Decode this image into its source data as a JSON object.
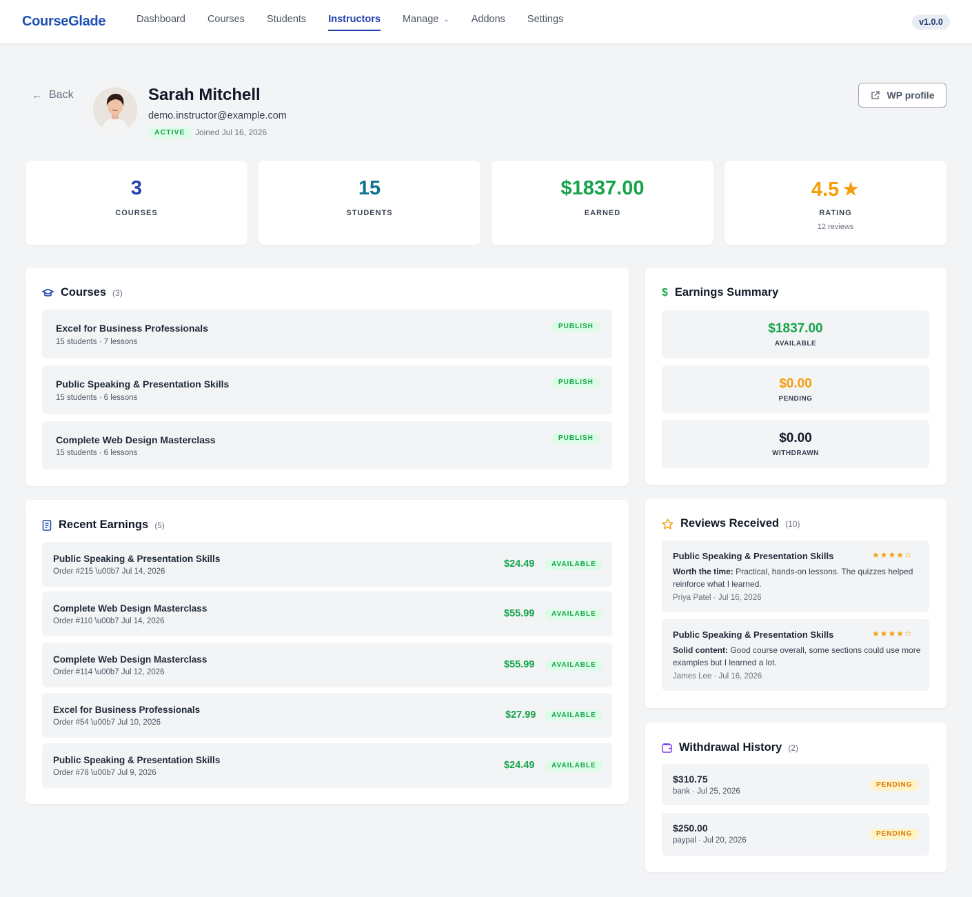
{
  "app": {
    "logo": "CourseGlade",
    "version": "v1.0.0"
  },
  "nav": {
    "items": [
      {
        "label": "Dashboard",
        "active": false
      },
      {
        "label": "Courses",
        "active": false
      },
      {
        "label": "Students",
        "active": false
      },
      {
        "label": "Instructors",
        "active": true
      },
      {
        "label": "Manage",
        "active": false,
        "dropdown": true
      },
      {
        "label": "Addons",
        "active": false
      },
      {
        "label": "Settings",
        "active": false
      }
    ]
  },
  "profile": {
    "back_label": "Back",
    "name": "Sarah Mitchell",
    "email": "demo.instructor@example.com",
    "status": "ACTIVE",
    "joined": "Joined Jul 16, 2026",
    "wp_button": "WP profile"
  },
  "stats": {
    "courses": {
      "value": "3",
      "label": "COURSES",
      "color": "#1e40af"
    },
    "students": {
      "value": "15",
      "label": "STUDENTS",
      "color": "#0e7490"
    },
    "earned": {
      "value": "$1837.00",
      "label": "EARNED",
      "color": "#16a34a"
    },
    "rating": {
      "value": "4.5",
      "label": "RATING",
      "sub": "12 reviews",
      "color": "#f59e0b"
    }
  },
  "courses": {
    "title": "Courses",
    "count": "(3)",
    "items": [
      {
        "title": "Excel for Business Professionals",
        "meta": "15 students · 7 lessons",
        "status": "PUBLISH"
      },
      {
        "title": "Public Speaking & Presentation Skills",
        "meta": "15 students · 6 lessons",
        "status": "PUBLISH"
      },
      {
        "title": "Complete Web Design Masterclass",
        "meta": "15 students · 6 lessons",
        "status": "PUBLISH"
      }
    ]
  },
  "earnings_summary": {
    "title": "Earnings Summary",
    "available": {
      "value": "$1837.00",
      "label": "AVAILABLE",
      "color": "#16a34a"
    },
    "pending": {
      "value": "$0.00",
      "label": "PENDING",
      "color": "#f59e0b"
    },
    "withdrawn": {
      "value": "$0.00",
      "label": "WITHDRAWN",
      "color": "#111827"
    }
  },
  "recent_earnings": {
    "title": "Recent Earnings",
    "count": "(5)",
    "items": [
      {
        "title": "Public Speaking & Presentation Skills",
        "meta": "Order #215 \\u00b7 Jul 14, 2026",
        "amount": "$24.49",
        "status": "AVAILABLE"
      },
      {
        "title": "Complete Web Design Masterclass",
        "meta": "Order #110 \\u00b7 Jul 14, 2026",
        "amount": "$55.99",
        "status": "AVAILABLE"
      },
      {
        "title": "Complete Web Design Masterclass",
        "meta": "Order #114 \\u00b7 Jul 12, 2026",
        "amount": "$55.99",
        "status": "AVAILABLE"
      },
      {
        "title": "Excel for Business Professionals",
        "meta": "Order #54 \\u00b7 Jul 10, 2026",
        "amount": "$27.99",
        "status": "AVAILABLE"
      },
      {
        "title": "Public Speaking & Presentation Skills",
        "meta": "Order #78 \\u00b7 Jul 9, 2026",
        "amount": "$24.49",
        "status": "AVAILABLE"
      }
    ]
  },
  "reviews": {
    "title": "Reviews Received",
    "count": "(10)",
    "items": [
      {
        "course": "Public Speaking & Presentation Skills",
        "stars": "★★★★☆",
        "rating": 4,
        "headline": "Worth the time:",
        "text": "Practical, hands-on lessons. The quizzes helped reinforce what I learned.",
        "by": "Priya Patel · Jul 16, 2026"
      },
      {
        "course": "Public Speaking & Presentation Skills",
        "stars": "★★★★☆",
        "rating": 4,
        "headline": "Solid content:",
        "text": "Good course overall, some sections could use more examples but I learned a lot.",
        "by": "James Lee · Jul 16, 2026"
      }
    ]
  },
  "withdrawals": {
    "title": "Withdrawal History",
    "count": "(2)",
    "items": [
      {
        "amount": "$310.75",
        "meta": "bank · Jul 25, 2026",
        "status": "PENDING"
      },
      {
        "amount": "$250.00",
        "meta": "paypal · Jul 20, 2026",
        "status": "PENDING"
      }
    ]
  },
  "icons": {
    "back": "arrow-left-icon",
    "wp": "external-link-icon",
    "courses": "graduation-cap-icon",
    "earnings": "dollar-icon",
    "recent": "receipt-icon",
    "reviews": "star-outline-icon",
    "withdrawals": "wallet-icon"
  }
}
